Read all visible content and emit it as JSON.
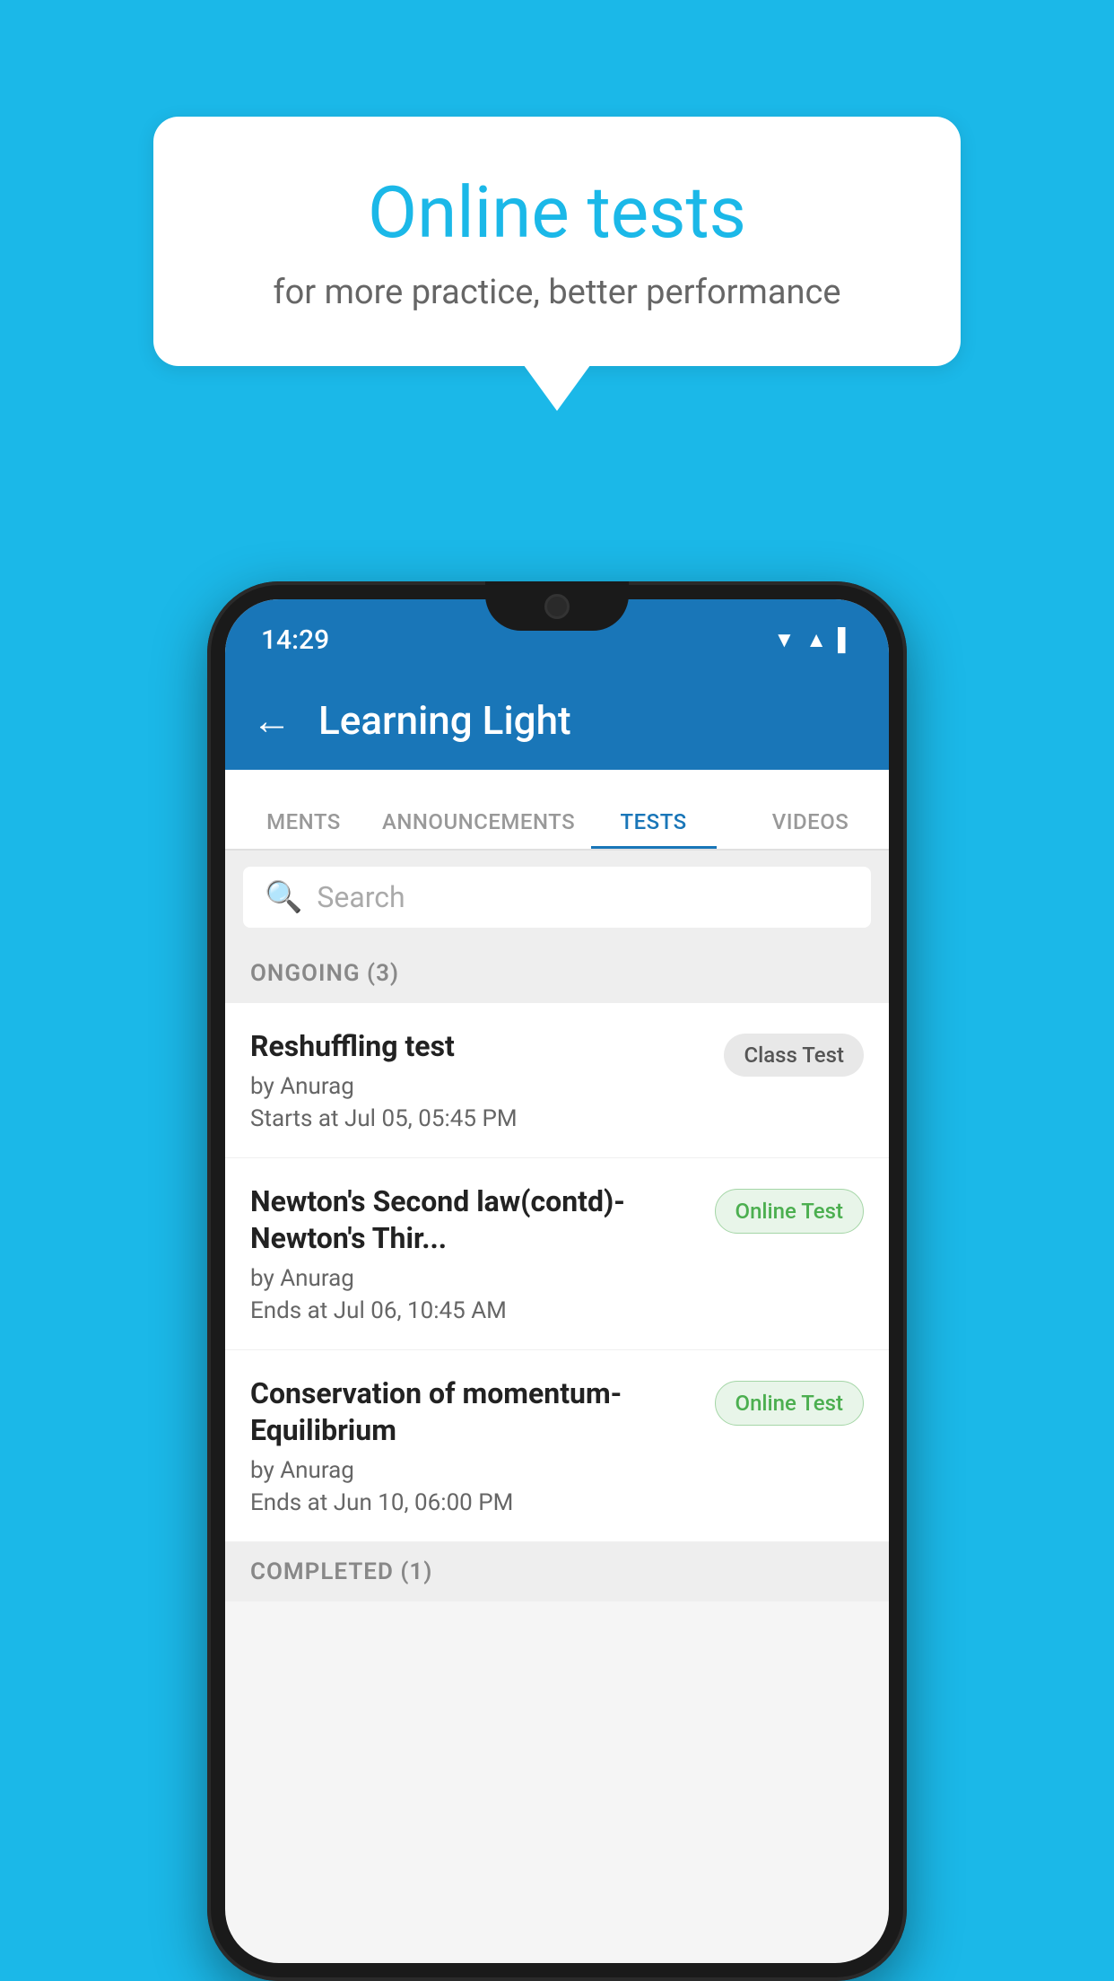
{
  "background_color": "#1bb8e8",
  "speech_bubble": {
    "title": "Online tests",
    "subtitle": "for more practice, better performance"
  },
  "phone": {
    "status_bar": {
      "time": "14:29",
      "icons": [
        "wifi",
        "signal",
        "battery"
      ]
    },
    "app_bar": {
      "back_label": "←",
      "title": "Learning Light"
    },
    "tabs": [
      {
        "label": "MENTS",
        "active": false
      },
      {
        "label": "ANNOUNCEMENTS",
        "active": false
      },
      {
        "label": "TESTS",
        "active": true
      },
      {
        "label": "VIDEOS",
        "active": false
      }
    ],
    "search": {
      "placeholder": "Search"
    },
    "sections": [
      {
        "header": "ONGOING (3)",
        "items": [
          {
            "title": "Reshuffling test",
            "author": "by Anurag",
            "date": "Starts at  Jul 05, 05:45 PM",
            "badge": "Class Test",
            "badge_type": "class"
          },
          {
            "title": "Newton's Second law(contd)-Newton's Thir...",
            "author": "by Anurag",
            "date": "Ends at  Jul 06, 10:45 AM",
            "badge": "Online Test",
            "badge_type": "online"
          },
          {
            "title": "Conservation of momentum-Equilibrium",
            "author": "by Anurag",
            "date": "Ends at  Jun 10, 06:00 PM",
            "badge": "Online Test",
            "badge_type": "online"
          }
        ]
      }
    ],
    "completed_header": "COMPLETED (1)"
  }
}
